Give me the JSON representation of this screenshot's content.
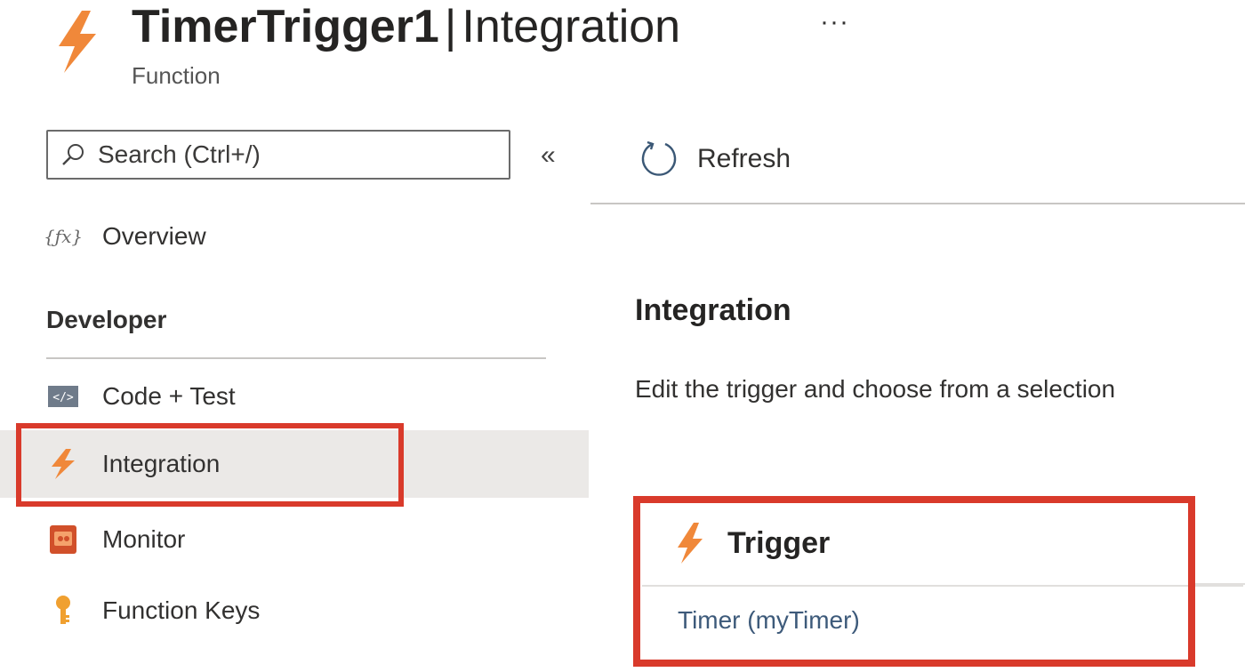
{
  "header": {
    "function_name": "TimerTrigger1",
    "separator": "|",
    "section": "Integration",
    "subtitle": "Function",
    "more_label": "···"
  },
  "sidebar": {
    "search_placeholder": "Search (Ctrl+/)",
    "collapse_label": "«",
    "overview_label": "Overview",
    "section_developer": "Developer",
    "items": [
      {
        "label": "Code + Test",
        "icon": "code-icon"
      },
      {
        "label": "Integration",
        "icon": "lightning-icon",
        "selected": true
      },
      {
        "label": "Monitor",
        "icon": "monitor-icon"
      },
      {
        "label": "Function Keys",
        "icon": "key-icon"
      }
    ]
  },
  "toolbar": {
    "refresh_label": "Refresh"
  },
  "main": {
    "heading": "Integration",
    "description": "Edit the trigger and choose from a selection",
    "trigger_card": {
      "title": "Trigger",
      "binding": "Timer (myTimer)"
    }
  },
  "colors": {
    "accent_orange": "#f0883a",
    "highlight_red": "#d93a2b",
    "selected_bg": "#ebe9e7"
  }
}
